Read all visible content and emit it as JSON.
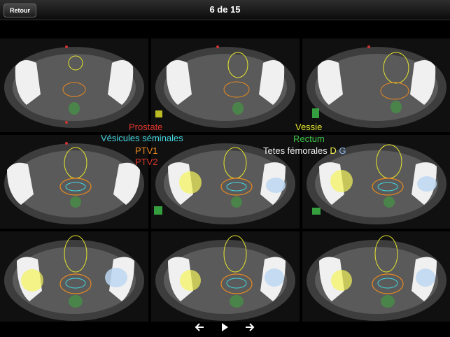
{
  "header": {
    "back_label": "Retour",
    "title": "6 de 15"
  },
  "legend": {
    "prostate": "Prostate",
    "vesicules": "Vésicules séminales",
    "ptv1": "PTV1",
    "ptv2": "PTV2",
    "vessie": "Vessie",
    "rectum": "Rectum",
    "tetes": "Tetes fémorales",
    "d": "D",
    "g": "G"
  },
  "colors": {
    "prostate": "#e0352b",
    "vesicules": "#43d6e0",
    "ptv1": "#e98a1f",
    "ptv2": "#d9342a",
    "vessie": "#e6e62c",
    "rectum": "#3fc24a",
    "tete_d": "#f3f35a",
    "tete_g": "#8ab6f0"
  },
  "icons": {
    "prev": "arrow-left-icon",
    "play": "play-icon",
    "next": "arrow-right-icon"
  }
}
